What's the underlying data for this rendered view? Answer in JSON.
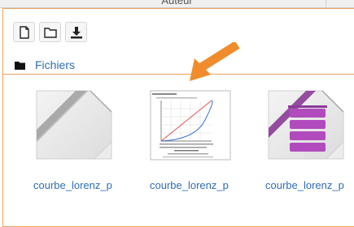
{
  "header": {
    "title": "Auteur"
  },
  "toolbar": {
    "buttons": [
      {
        "name": "create-file",
        "icon": "file-icon"
      },
      {
        "name": "create-folder",
        "icon": "folder-icon"
      },
      {
        "name": "download",
        "icon": "download-icon"
      }
    ]
  },
  "path": {
    "label": "Fichiers"
  },
  "files": [
    {
      "label": "courbe_lorenz_p",
      "icon": "generic-document-icon"
    },
    {
      "label": "courbe_lorenz_p",
      "icon": "image-preview-icon"
    },
    {
      "label": "courbe_lorenz_p",
      "icon": "database-document-icon"
    }
  ],
  "colors": {
    "accent": "#f3a25b",
    "arrow": "#f08c2c",
    "link": "#2e6db3"
  }
}
